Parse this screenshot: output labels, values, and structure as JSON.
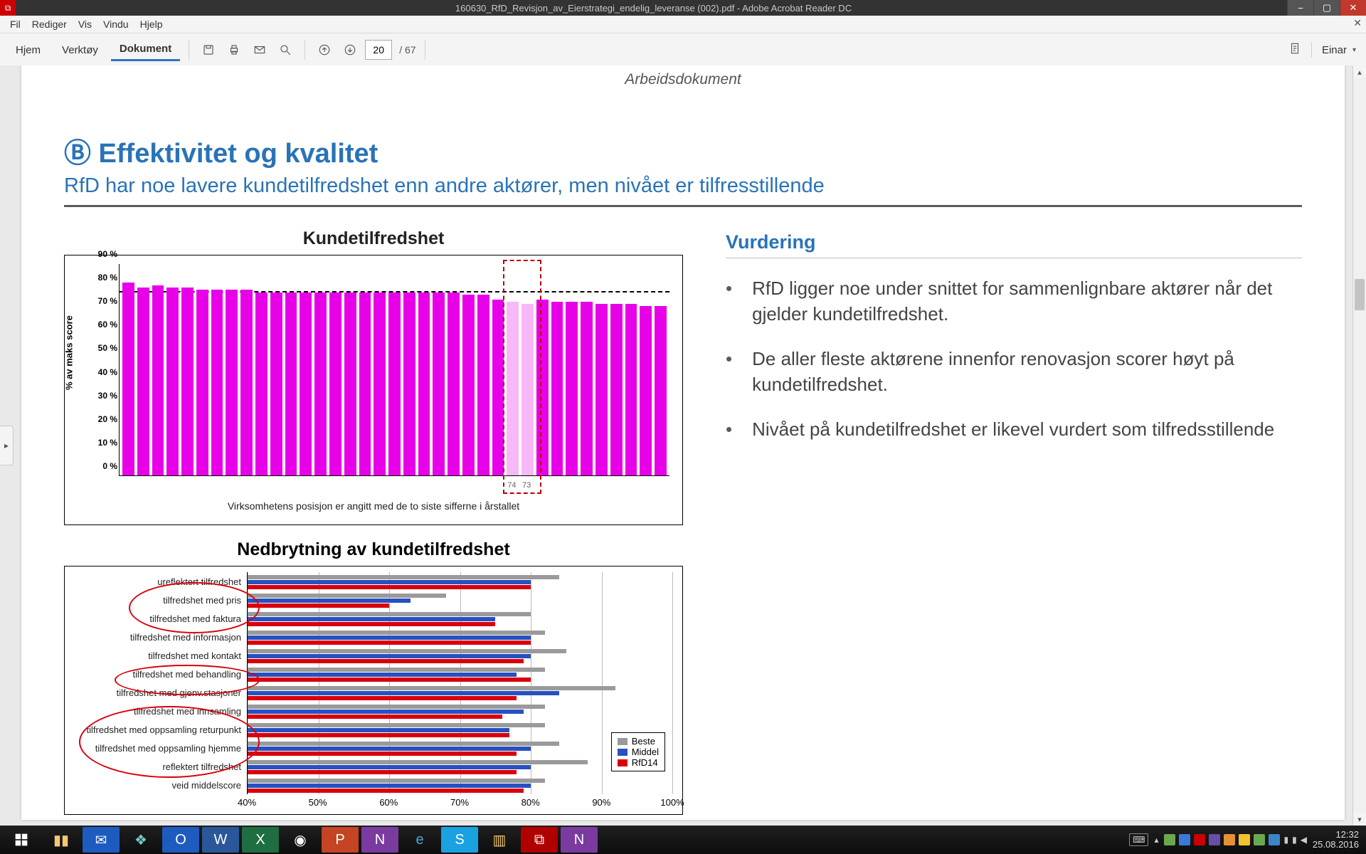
{
  "window": {
    "title": "160630_RfD_Revisjon_av_Eierstrategi_endelig_leveranse (002).pdf - Adobe Acrobat Reader DC"
  },
  "menubar": {
    "items": [
      "Fil",
      "Rediger",
      "Vis",
      "Vindu",
      "Hjelp"
    ]
  },
  "toolbar": {
    "tabs": {
      "home": "Hjem",
      "tools": "Verktøy",
      "document": "Dokument"
    },
    "page_current": "20",
    "page_total": "/ 67",
    "user": "Einar"
  },
  "doc": {
    "header": "Arbeidsdokument",
    "section_title": "Ⓑ Effektivitet og kvalitet",
    "section_sub": "RfD har noe lavere kundetilfredshet enn andre aktører, men nivået er tilfresstillende",
    "chart1_title": "Kundetilfredshet",
    "chart1_ylabel": "% av maks score",
    "chart1_caption": "Virksomhetens posisjon er angitt med de to siste sifferne i årstallet",
    "chart2_title": "Nedbrytning av kundetilfredshet",
    "assessment_title": "Vurdering",
    "bullets": [
      "RfD ligger noe under snittet for sammenlignbare aktører når det gjelder kundetilfredshet.",
      "De aller fleste aktørene innenfor renovasjon scorer høyt på kundetilfredshet.",
      "Nivået på kundetilfredshet  er likevel vurdert som tilfredsstillende"
    ]
  },
  "chart_data": [
    {
      "type": "bar",
      "title": "Kundetilfredshet",
      "ylabel": "% av maks score",
      "ylim": [
        0,
        90
      ],
      "reference_line": 78,
      "yticks": [
        "0 %",
        "10 %",
        "20 %",
        "30 %",
        "40 %",
        "50/%",
        "60 %",
        "70 %",
        "80 %",
        "90 %"
      ],
      "values": [
        82,
        80,
        81,
        80,
        80,
        79,
        79,
        79,
        79,
        78,
        78,
        78,
        78,
        78,
        78,
        78,
        78,
        78,
        78,
        78,
        78,
        78,
        78,
        77,
        77,
        75,
        74,
        73,
        75,
        74,
        74,
        74,
        73,
        73,
        73,
        72,
        72
      ],
      "highlight_indices": [
        26,
        27
      ],
      "highlight_labels": [
        "74",
        "73"
      ],
      "note": "Virksomhetens posisjon er angitt med de to siste sifferne i årstallet"
    },
    {
      "type": "bar",
      "orientation": "horizontal",
      "title": "Nedbrytning av kundetilfredshet",
      "xlabel": "",
      "xlim": [
        40,
        100
      ],
      "xticks": [
        "40%",
        "50%",
        "60%",
        "70%",
        "80%",
        "90%",
        "100%"
      ],
      "categories": [
        "ureflektert tilfredshet",
        "tilfredshet med pris",
        "tilfredshet med faktura",
        "tilfredshet med informasjon",
        "tilfredshet med kontakt",
        "tilfredshet med behandling",
        "tilfredshet med gjenv.stasjoner",
        "tilfredshet med innsamling",
        "tilfredshet med oppsamling returpunkt",
        "tilfredshet med oppsamling hjemme",
        "reflektert tilfredshet",
        "veid middelscore"
      ],
      "series": [
        {
          "name": "Beste",
          "color": "#9a9a9a",
          "values": [
            84,
            68,
            80,
            82,
            85,
            82,
            92,
            82,
            82,
            84,
            88,
            82
          ]
        },
        {
          "name": "Middel",
          "color": "#2750c0",
          "values": [
            80,
            63,
            75,
            80,
            80,
            78,
            84,
            79,
            77,
            80,
            80,
            80
          ]
        },
        {
          "name": "RfD14",
          "color": "#d8000c",
          "values": [
            80,
            60,
            75,
            80,
            79,
            80,
            78,
            76,
            77,
            78,
            78,
            79
          ]
        }
      ],
      "circled_categories": [
        "tilfredshet med pris",
        "tilfredshet med faktura",
        "tilfredshet med behandling",
        "tilfredshet med innsamling",
        "tilfredshet med oppsamling returpunkt",
        "tilfredshet med oppsamling hjemme"
      ],
      "legend_position": "bottom-right"
    }
  ],
  "taskbar": {
    "clock_time": "12:32",
    "clock_date": "25.08.2016"
  }
}
